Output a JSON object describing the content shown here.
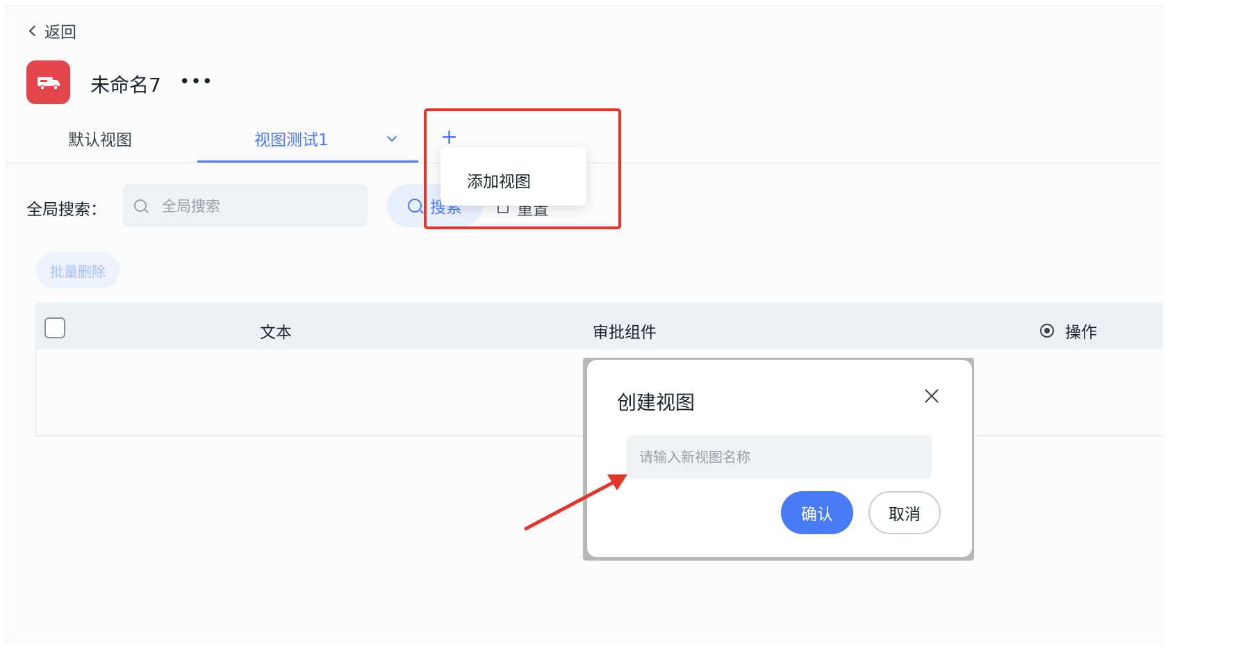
{
  "header": {
    "back_label": "返回",
    "app_title": "未命名7",
    "more_label": "•••"
  },
  "tabs": {
    "items": [
      {
        "label": "默认视图",
        "active": false
      },
      {
        "label": "视图测试1",
        "active": true
      }
    ],
    "add_label": "+",
    "add_menu_item": "添加视图"
  },
  "search": {
    "label": "全局搜索：",
    "placeholder": "全局搜索",
    "search_button": "搜索",
    "reset_button": "重置"
  },
  "toolbar": {
    "batch_delete": "批量删除"
  },
  "table": {
    "columns": [
      "文本",
      "审批组件",
      "操作"
    ]
  },
  "modal": {
    "title": "创建视图",
    "input_placeholder": "请输入新视图名称",
    "input_value": "",
    "confirm": "确认",
    "cancel": "取消"
  },
  "colors": {
    "accent": "#4a7bf7",
    "app_icon": "#e3464c",
    "annotation": "#e2352b"
  }
}
